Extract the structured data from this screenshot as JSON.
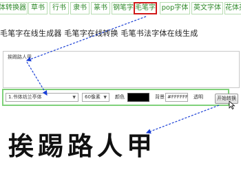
{
  "tabs": [
    "体转换器",
    "草书",
    "行书",
    "隶书",
    "篆书",
    "钢笔字",
    "毛笔字",
    "pop字体",
    "英文字体",
    "花体英"
  ],
  "active_tab": 6,
  "subtitle": "毛笔字在线生成器 毛笔字在线转换 毛笔书法字体在线生成",
  "input": {
    "value": "挨踢路人甲"
  },
  "options": {
    "font_select": "1.书体坊兰亭体",
    "size_select": "60像素",
    "color_label": "颜色",
    "color_value": "#000000",
    "bg_label": "背景",
    "bg_value": "#FFFFFF",
    "transparent_label": "透明"
  },
  "generate_button": "开始转换",
  "result_text": "挨踢路人甲",
  "colors": {
    "tab_border": "#b7dcb1",
    "tab_text": "#2f8a2a",
    "active_border": "#d01818",
    "annot_line": "#1a3fd6"
  }
}
